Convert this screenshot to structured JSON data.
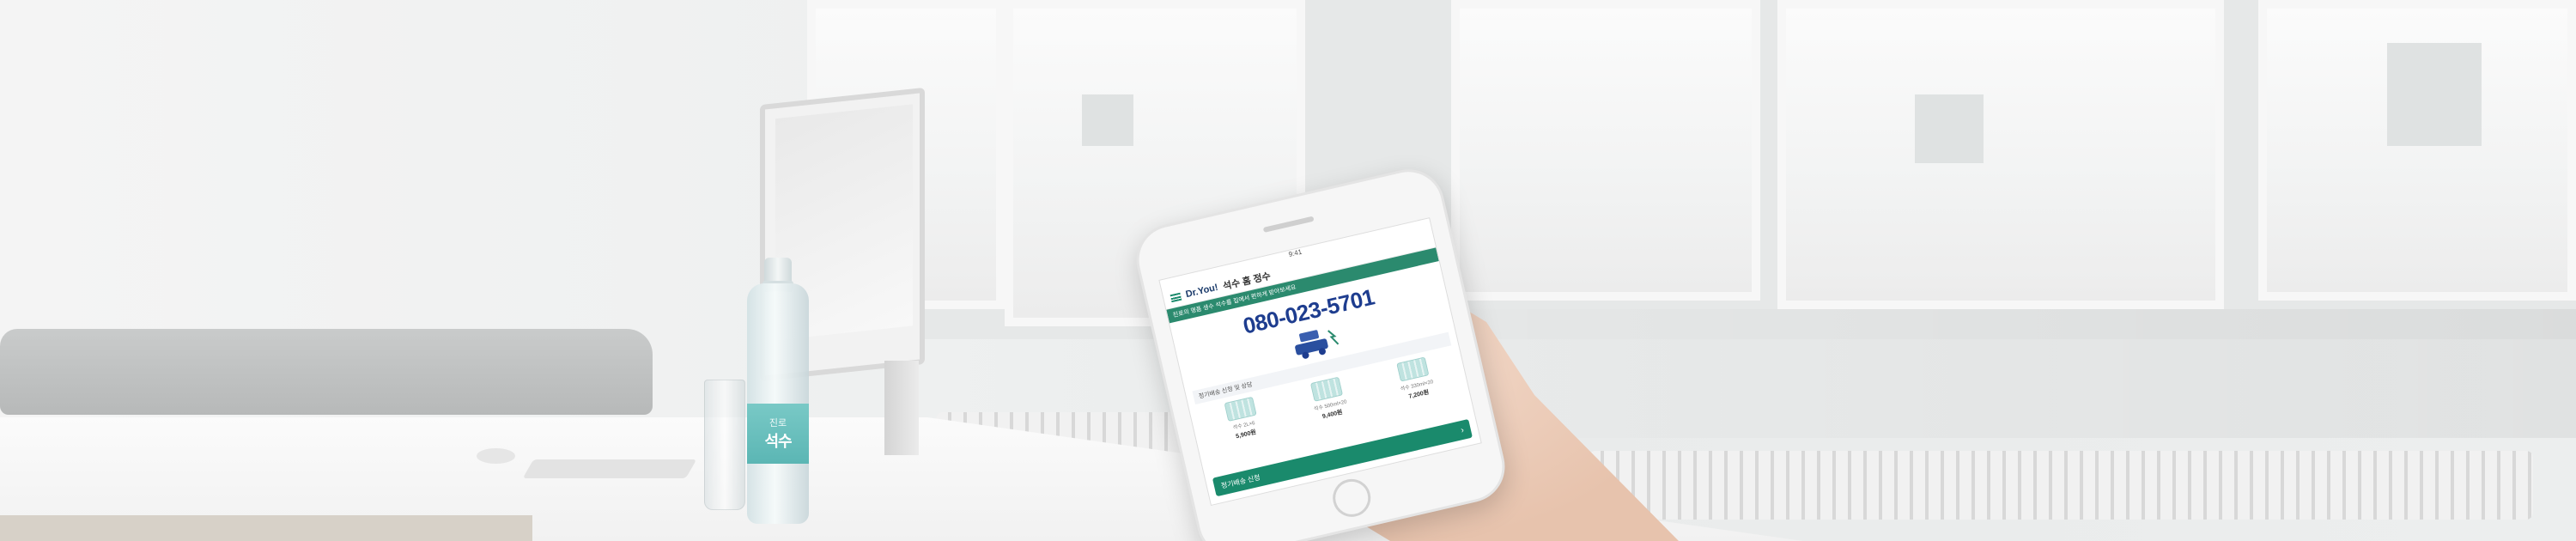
{
  "bottle": {
    "brand": "진로",
    "name": "석수"
  },
  "phone_app": {
    "status_time": "9:41",
    "logo": "Dr.You!",
    "title": "석수 홈 정수",
    "banner_text": "진로의 명품 생수 석수를 집에서 편하게 받아보세요",
    "phone_number": "080-023-5701",
    "sub_banner_text": "정기배송 신청 및 상담",
    "products": [
      {
        "label": "석수 2L×6",
        "price": "5,900원"
      },
      {
        "label": "석수 500ml×20",
        "price": "9,400원"
      },
      {
        "label": "석수 330ml×20",
        "price": "7,200원"
      }
    ],
    "cta_label": "정기배송 신청",
    "cta_chevron": "›"
  },
  "colors": {
    "accent": "#1a8a6c",
    "number_blue": "#1e3d8f"
  }
}
